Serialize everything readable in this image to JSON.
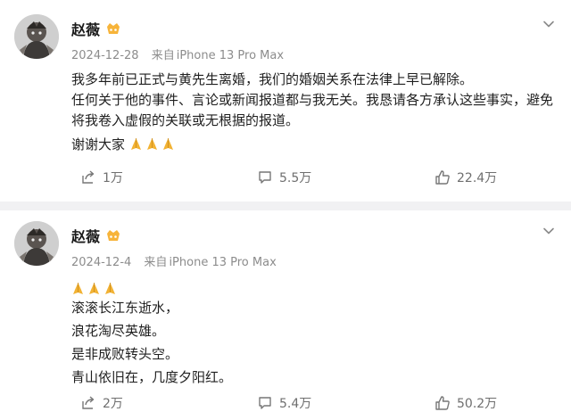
{
  "posts": [
    {
      "author": "赵薇",
      "meta": {
        "date": "2024-12-28",
        "source_prefix": "来自",
        "device": "iPhone 13 Pro Max"
      },
      "lines": [
        "我多年前已正式与黄先生离婚，我们的婚姻关系在法律上早已解除。",
        "任何关于他的事件、言论或新闻报道都与我无关。我恳请各方承认这些事实，避免",
        "将我卷入虚假的关联或无根据的报道。",
        "谢谢大家"
      ],
      "trailing_emoji": "pray-emoji x3",
      "actions": {
        "share": "1万",
        "comment": "5.5万",
        "like": "22.4万"
      }
    },
    {
      "author": "赵薇",
      "meta": {
        "date": "2024-12-4",
        "source_prefix": "来自",
        "device": "iPhone 13 Pro Max"
      },
      "leading_emoji": "pray-emoji x3",
      "lines": [
        "滚滚长江东逝水，",
        "浪花淘尽英雄。",
        "是非成败转头空。",
        "青山依旧在，几度夕阳红。"
      ],
      "actions": {
        "share": "2万",
        "comment": "5.4万",
        "like": "50.2万"
      }
    }
  ],
  "icons": [
    "chevron-down-icon",
    "share-icon",
    "comment-icon",
    "like-icon",
    "vip-badge-icon",
    "pray-emoji"
  ],
  "colors": {
    "background": "#f1f1f3",
    "card": "#ffffff",
    "text": "#1f1f1f",
    "meta": "#8c8c8c",
    "emoji": "#f2b233"
  }
}
